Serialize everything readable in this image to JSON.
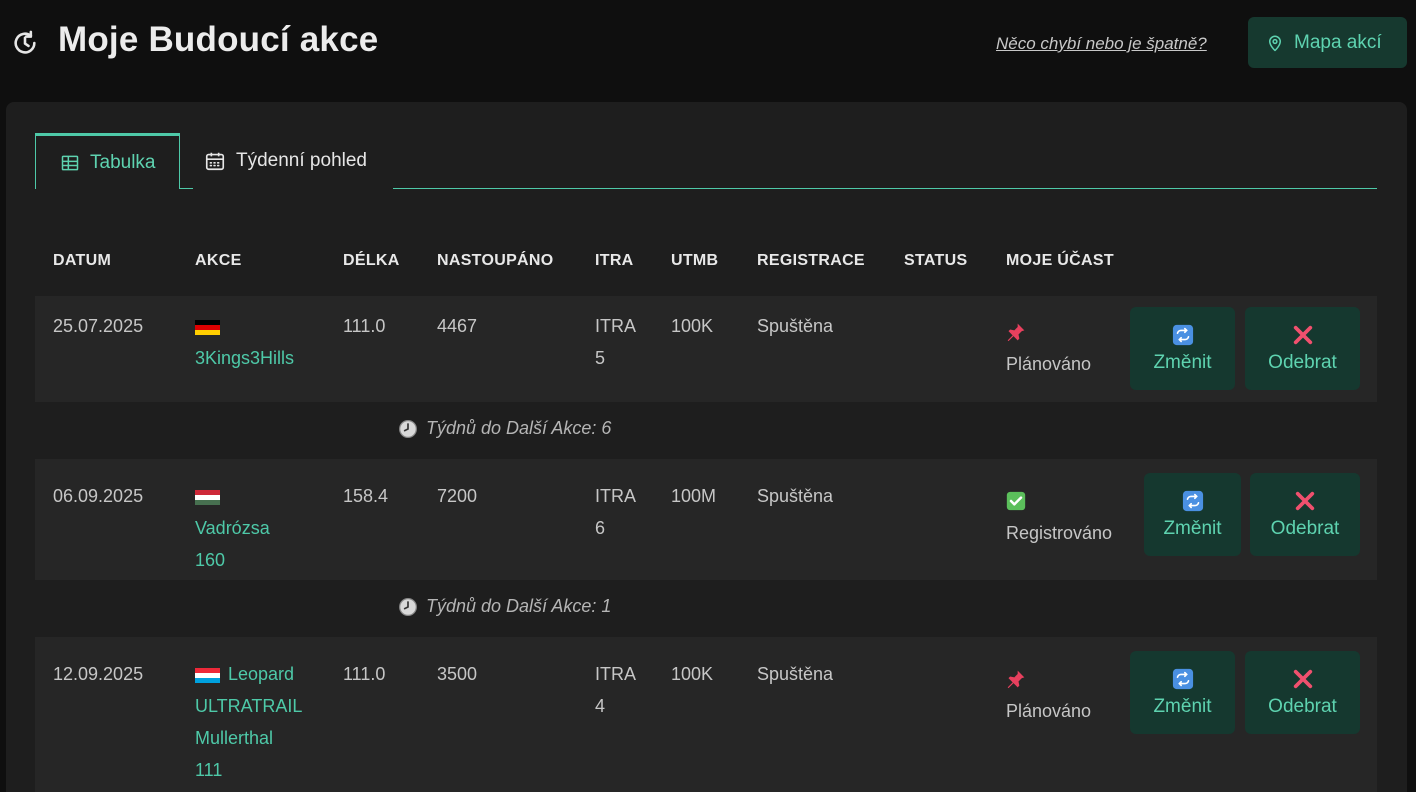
{
  "header": {
    "title": "Moje Budoucí akce",
    "report_link": "Něco chybí nebo je špatně?",
    "map_button": "Mapa akcí"
  },
  "tabs": [
    {
      "label": "Tabulka",
      "active": true
    },
    {
      "label": "Týdenní pohled",
      "active": false
    }
  ],
  "table": {
    "columns": [
      "DATUM",
      "AKCE",
      "DÉLKA",
      "NASTOUPÁNO",
      "ITRA",
      "UTMB",
      "REGISTRACE",
      "STATUS",
      "MOJE ÚČAST"
    ],
    "rows": [
      {
        "date": "25.07.2025",
        "flag": "de",
        "event_lines": [
          "3Kings3Hills"
        ],
        "length": "111.0",
        "elevation": "4467",
        "itra_label": "ITRA",
        "itra_value": "5",
        "utmb": "100K",
        "registration": "Spuštěna",
        "status": "",
        "participation_icon": "pushpin-icon",
        "participation": "Plánováno",
        "change_label": "Změnit",
        "remove_label": "Odebrat"
      },
      {
        "date": "06.09.2025",
        "flag": "hu",
        "event_lines": [
          "Vadrózsa",
          "160"
        ],
        "length": "158.4",
        "elevation": "7200",
        "itra_label": "ITRA",
        "itra_value": "6",
        "utmb": "100M",
        "registration": "Spuštěna",
        "status": "",
        "participation_icon": "check-mark-icon",
        "participation": "Registrováno",
        "change_label": "Změnit",
        "remove_label": "Odebrat"
      },
      {
        "date": "12.09.2025",
        "flag": "lu",
        "event_lines": [
          "Leopard",
          "ULTRATRAIL",
          "Mullerthal",
          "111"
        ],
        "length": "111.0",
        "elevation": "3500",
        "itra_label": "ITRA",
        "itra_value": "4",
        "utmb": "100K",
        "registration": "Spuštěna",
        "status": "",
        "participation_icon": "pushpin-icon",
        "participation": "Plánováno",
        "change_label": "Změnit",
        "remove_label": "Odebrat"
      }
    ],
    "gaps": [
      {
        "text": "Týdnů do Další Akce: 6"
      },
      {
        "text": "Týdnů do Další Akce: 1"
      }
    ]
  },
  "colors": {
    "accent": "#4ec9a8",
    "button_bg": "#15382f",
    "remove_icon": "#f0506e",
    "change_icon": "#4a90e2"
  }
}
